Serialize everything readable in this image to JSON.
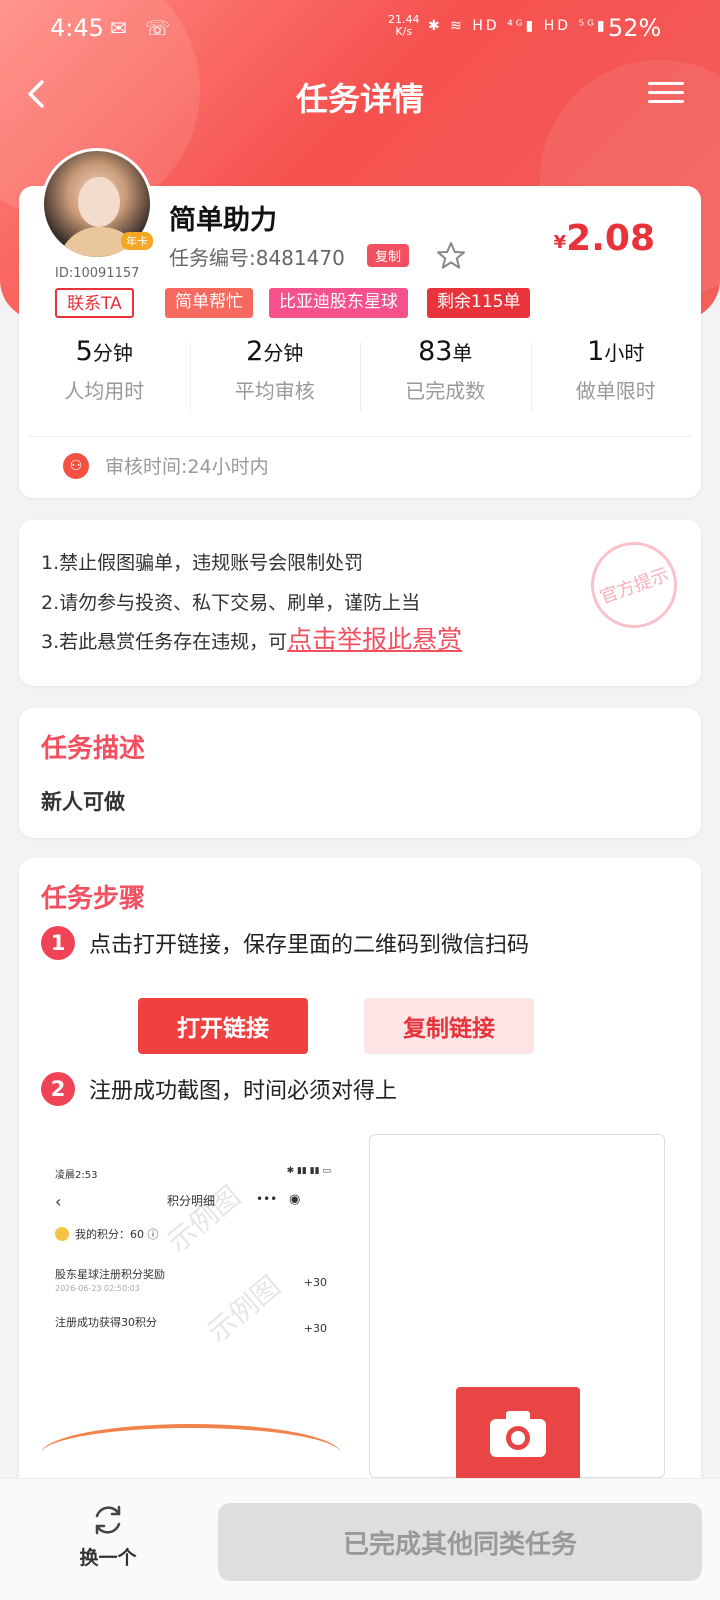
{
  "status_bar": {
    "time": "4:45",
    "left_icons": "✉ ☏",
    "net_speed": "21.44",
    "net_unit": "K/s",
    "right_icons": "✱ ≋ HD ⁴ᴳ▮ HD ⁵ᴳ▮",
    "battery": "52%"
  },
  "nav": {
    "title": "任务详情"
  },
  "task": {
    "name": "简单助力",
    "number_label": "任务编号:8481470",
    "copy_label": "复制",
    "price_currency": "¥",
    "price": "2.08",
    "user_id": "ID:10091157",
    "vip_badge": "年卡",
    "contact_label": "联系TA",
    "tags": [
      "简单帮忙",
      "比亚迪股东星球",
      "剩余115单"
    ]
  },
  "stats": [
    {
      "value": "5",
      "unit": "分钟",
      "label": "人均用时"
    },
    {
      "value": "2",
      "unit": "分钟",
      "label": "平均审核"
    },
    {
      "value": "83",
      "unit": "单",
      "label": "已完成数"
    },
    {
      "value": "1",
      "unit": "小时",
      "label": "做单限时"
    }
  ],
  "audit": {
    "icon": "⚇",
    "text": "审核时间:24小时内"
  },
  "notice": {
    "line1": "1.禁止假图骗单，违规账号会限制处罚",
    "line2": "2.请勿参与投资、私下交易、刷单，谨防上当",
    "line3_prefix": "3.若此悬赏任务存在违规，可",
    "line3_link": "点击举报此悬赏",
    "stamp": "官方提示"
  },
  "description": {
    "title": "任务描述",
    "text": "新人可做"
  },
  "steps": {
    "title": "任务步骤",
    "step1_num": "1",
    "step1_text": "点击打开链接，保存里面的二维码到微信扫码",
    "open_link": "打开链接",
    "copy_link": "复制链接",
    "step2_num": "2",
    "step2_text": "注册成功截图，时间必须对得上",
    "sample": {
      "status_time": "凌晨2:53",
      "status_icons": "✱ ▮▮ ▮▮ ▭",
      "back": "‹",
      "title": "积分明细",
      "dots": "•••",
      "target": "◉",
      "points": "我的积分：60 ⓘ",
      "row1": "股东星球注册积分奖励",
      "row1_date": "2026-06-23 02:50:03",
      "row1_val": "+30",
      "row2": "注册成功获得30积分",
      "row2_val": "+30",
      "watermark1": "示例图",
      "watermark2": "示例图"
    }
  },
  "bottom": {
    "swap_label": "换一个",
    "done_label": "已完成其他同类任务"
  }
}
